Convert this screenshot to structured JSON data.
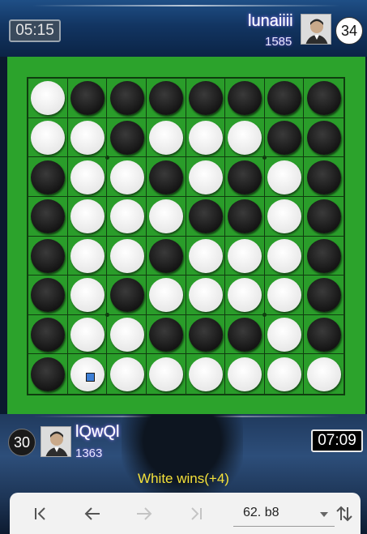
{
  "top_player": {
    "name": "lunaiiii",
    "rating": "1585",
    "timer": "05:15",
    "score": "34"
  },
  "bottom_player": {
    "name": "lQwQl",
    "rating": "1363",
    "timer": "07:09",
    "score": "30"
  },
  "result": "White wins(+4)",
  "move_select": {
    "value": "62. b8"
  },
  "controls": {
    "first": "first-move-icon",
    "prev": "previous-move-icon",
    "next": "next-move-icon",
    "last": "last-move-icon",
    "flip": "flip-board-icon"
  },
  "colors": {
    "board": "#2a9d2a",
    "result_text": "#f5e13a",
    "last_move_marker": "#3d7fd6"
  },
  "board": {
    "rows": [
      "WBBBBBBB",
      "WWBWWWBB",
      "BWWBWBWB",
      "BWWWBBWB",
      "BWWBWWWB",
      "BWBWWWWB",
      "BWWBBBWB",
      "BWWWWWWW"
    ],
    "last_move": "b8"
  }
}
